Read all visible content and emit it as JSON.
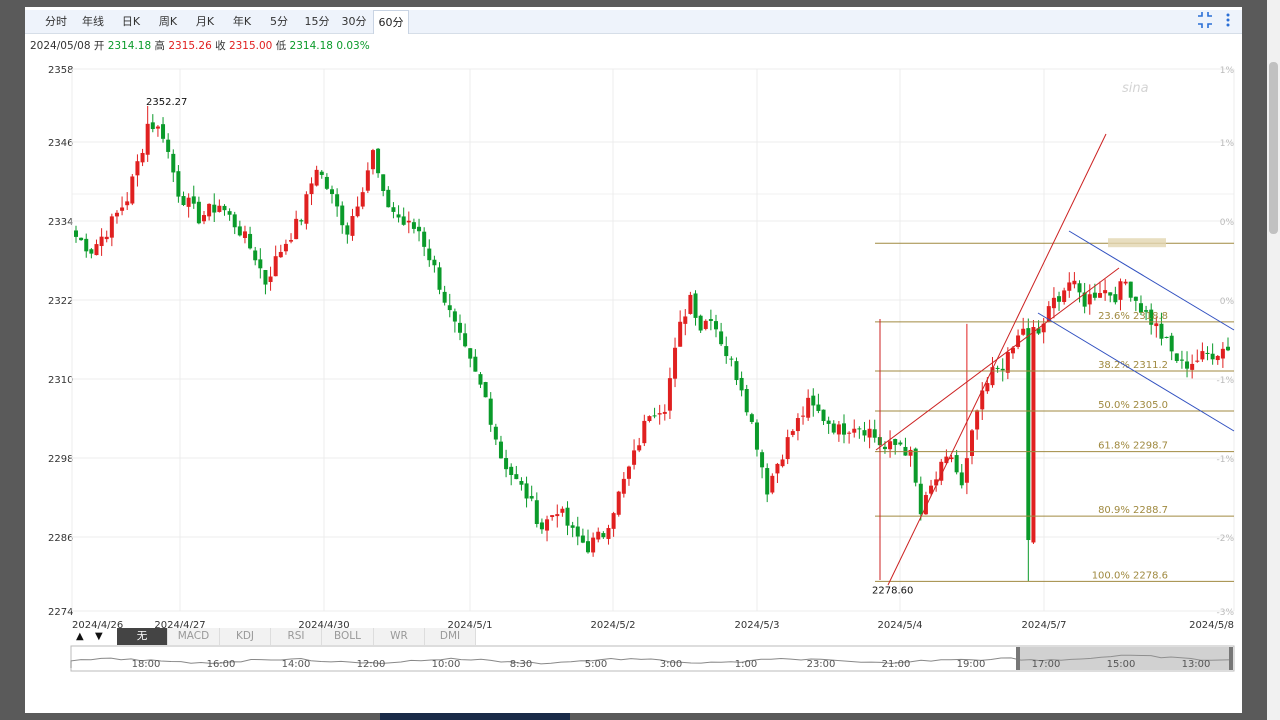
{
  "tabs": [
    {
      "label": "分时",
      "active": false
    },
    {
      "label": "年线",
      "active": false
    },
    {
      "label": "日K",
      "active": false
    },
    {
      "label": "周K",
      "active": false
    },
    {
      "label": "月K",
      "active": false
    },
    {
      "label": "年K",
      "active": false
    },
    {
      "label": "5分",
      "active": false
    },
    {
      "label": "15分",
      "active": false
    },
    {
      "label": "30分",
      "active": false
    },
    {
      "label": "60分",
      "active": true
    }
  ],
  "toolbar": {
    "fullscreen_icon": "fullscreen-icon",
    "more_icon": "more-vertical-icon"
  },
  "info": {
    "date": "2024/05/08",
    "open_label": "开",
    "open": "2314.18",
    "high_label": "高",
    "high": "2315.26",
    "close_label": "收",
    "close": "2315.00",
    "low_label": "低",
    "low": "2314.18",
    "change": "0.03%"
  },
  "colors": {
    "up": "#e02020",
    "down": "#0a9a2a",
    "fib": "#a08a40",
    "channel_red": "#cc2222",
    "channel_blue": "#3050c0"
  },
  "chart_data": {
    "type": "candlestick",
    "ylim": [
      2274,
      2358
    ],
    "y_ticks": [
      "2358",
      "2346",
      "2334",
      "2322",
      "2310",
      "2298",
      "2286",
      "2274"
    ],
    "right_ticks": [
      "1%",
      "1%",
      "0%",
      "0%",
      "-1%",
      "-1%",
      "-2%",
      "-3%"
    ],
    "x_labels": [
      "2024/4/26",
      "2024/4/27",
      "2024/4/30",
      "2024/5/1",
      "2024/5/2",
      "2024/5/3",
      "2024/5/4",
      "2024/5/7",
      "2024/5/8"
    ],
    "annotations": [
      {
        "text": "2352.27",
        "price": 2352.27
      },
      {
        "text": "2278.60",
        "price": 2278.6
      }
    ],
    "fibonacci": [
      {
        "label": "23.6% 2318.8",
        "price": 2318.8
      },
      {
        "label": "38.2% 2311.2",
        "price": 2311.2
      },
      {
        "label": "50.0% 2305.0",
        "price": 2305.0
      },
      {
        "label": "61.8% 2298.7",
        "price": 2298.7
      },
      {
        "label": "80.9% 2288.7",
        "price": 2288.7
      },
      {
        "label": "100.0% 2278.6",
        "price": 2278.6
      }
    ],
    "fib_top_price": 2331.0,
    "waypoints": [
      [
        0,
        2332
      ],
      [
        3,
        2330
      ],
      [
        6,
        2333
      ],
      [
        10,
        2338
      ],
      [
        13,
        2346
      ],
      [
        14,
        2350
      ],
      [
        17,
        2348
      ],
      [
        20,
        2339
      ],
      [
        24,
        2335
      ],
      [
        28,
        2337
      ],
      [
        32,
        2333
      ],
      [
        35,
        2329
      ],
      [
        37,
        2325
      ],
      [
        40,
        2330
      ],
      [
        44,
        2335
      ],
      [
        47,
        2343
      ],
      [
        50,
        2338
      ],
      [
        53,
        2333
      ],
      [
        56,
        2340
      ],
      [
        58,
        2345
      ],
      [
        60,
        2338
      ],
      [
        64,
        2334
      ],
      [
        67,
        2333
      ],
      [
        70,
        2327
      ],
      [
        73,
        2320
      ],
      [
        76,
        2314
      ],
      [
        80,
        2307
      ],
      [
        83,
        2298
      ],
      [
        86,
        2294
      ],
      [
        88,
        2292
      ],
      [
        91,
        2287
      ],
      [
        94,
        2290
      ],
      [
        97,
        2286
      ],
      [
        100,
        2284
      ],
      [
        103,
        2286
      ],
      [
        106,
        2292
      ],
      [
        109,
        2298
      ],
      [
        112,
        2305
      ],
      [
        115,
        2306
      ],
      [
        118,
        2318
      ],
      [
        120,
        2323
      ],
      [
        122,
        2318
      ],
      [
        124,
        2320
      ],
      [
        127,
        2314
      ],
      [
        130,
        2309
      ],
      [
        133,
        2300
      ],
      [
        135,
        2293
      ],
      [
        137,
        2297
      ],
      [
        140,
        2302
      ],
      [
        143,
        2306
      ],
      [
        146,
        2304
      ],
      [
        149,
        2302
      ],
      [
        152,
        2303
      ],
      [
        155,
        2302
      ],
      [
        158,
        2299
      ],
      [
        161,
        2300
      ],
      [
        163,
        2298
      ],
      [
        165,
        2289
      ],
      [
        167,
        2293
      ],
      [
        169,
        2296
      ],
      [
        171,
        2298
      ],
      [
        173,
        2293
      ],
      [
        176,
        2305
      ],
      [
        179,
        2311
      ],
      [
        182,
        2313
      ],
      [
        185,
        2318
      ],
      [
        188,
        2317
      ],
      [
        191,
        2322
      ],
      [
        194,
        2325
      ],
      [
        197,
        2322
      ],
      [
        200,
        2324
      ],
      [
        203,
        2323
      ],
      [
        205,
        2325
      ],
      [
        208,
        2321
      ],
      [
        211,
        2318
      ],
      [
        214,
        2314
      ],
      [
        216,
        2312
      ],
      [
        219,
        2313
      ],
      [
        222,
        2314
      ],
      [
        225,
        2315
      ]
    ],
    "seed": 7
  }
}
